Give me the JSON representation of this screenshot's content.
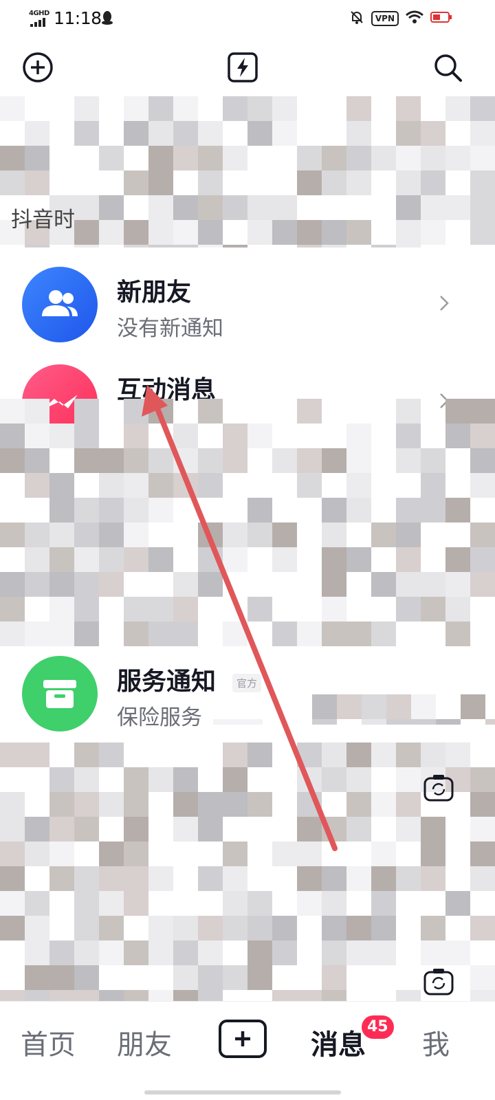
{
  "status_bar": {
    "network_label": "4GHD",
    "time": "11:18",
    "vpn_label": "VPN",
    "icons": [
      "signal-icon",
      "qq-icon",
      "mute-bell-icon",
      "wifi-icon",
      "battery-icon"
    ]
  },
  "top_bar": {
    "icons": [
      "add-circle-icon",
      "lightning-icon",
      "search-icon"
    ]
  },
  "stories": {
    "label_visible": "抖音时"
  },
  "list": {
    "new_friends": {
      "title": "新朋友",
      "subtitle": "没有新通知",
      "icon": "people-icon",
      "color": "#2f6ff5"
    },
    "interactions": {
      "title": "互动消息",
      "icon": "zigzag-icon",
      "color": "#fe2c55"
    },
    "service": {
      "title": "服务通知",
      "tag": "官方",
      "subtitle": "保险服务",
      "icon": "inbox-icon",
      "color": "#3fcf6b"
    }
  },
  "bottom_nav": {
    "home": "首页",
    "friends": "朋友",
    "messages": "消息",
    "messages_badge": "45",
    "me": "我",
    "active": "消息"
  },
  "colors": {
    "accent": "#fe2c55",
    "annotation_arrow": "#e0575a"
  }
}
